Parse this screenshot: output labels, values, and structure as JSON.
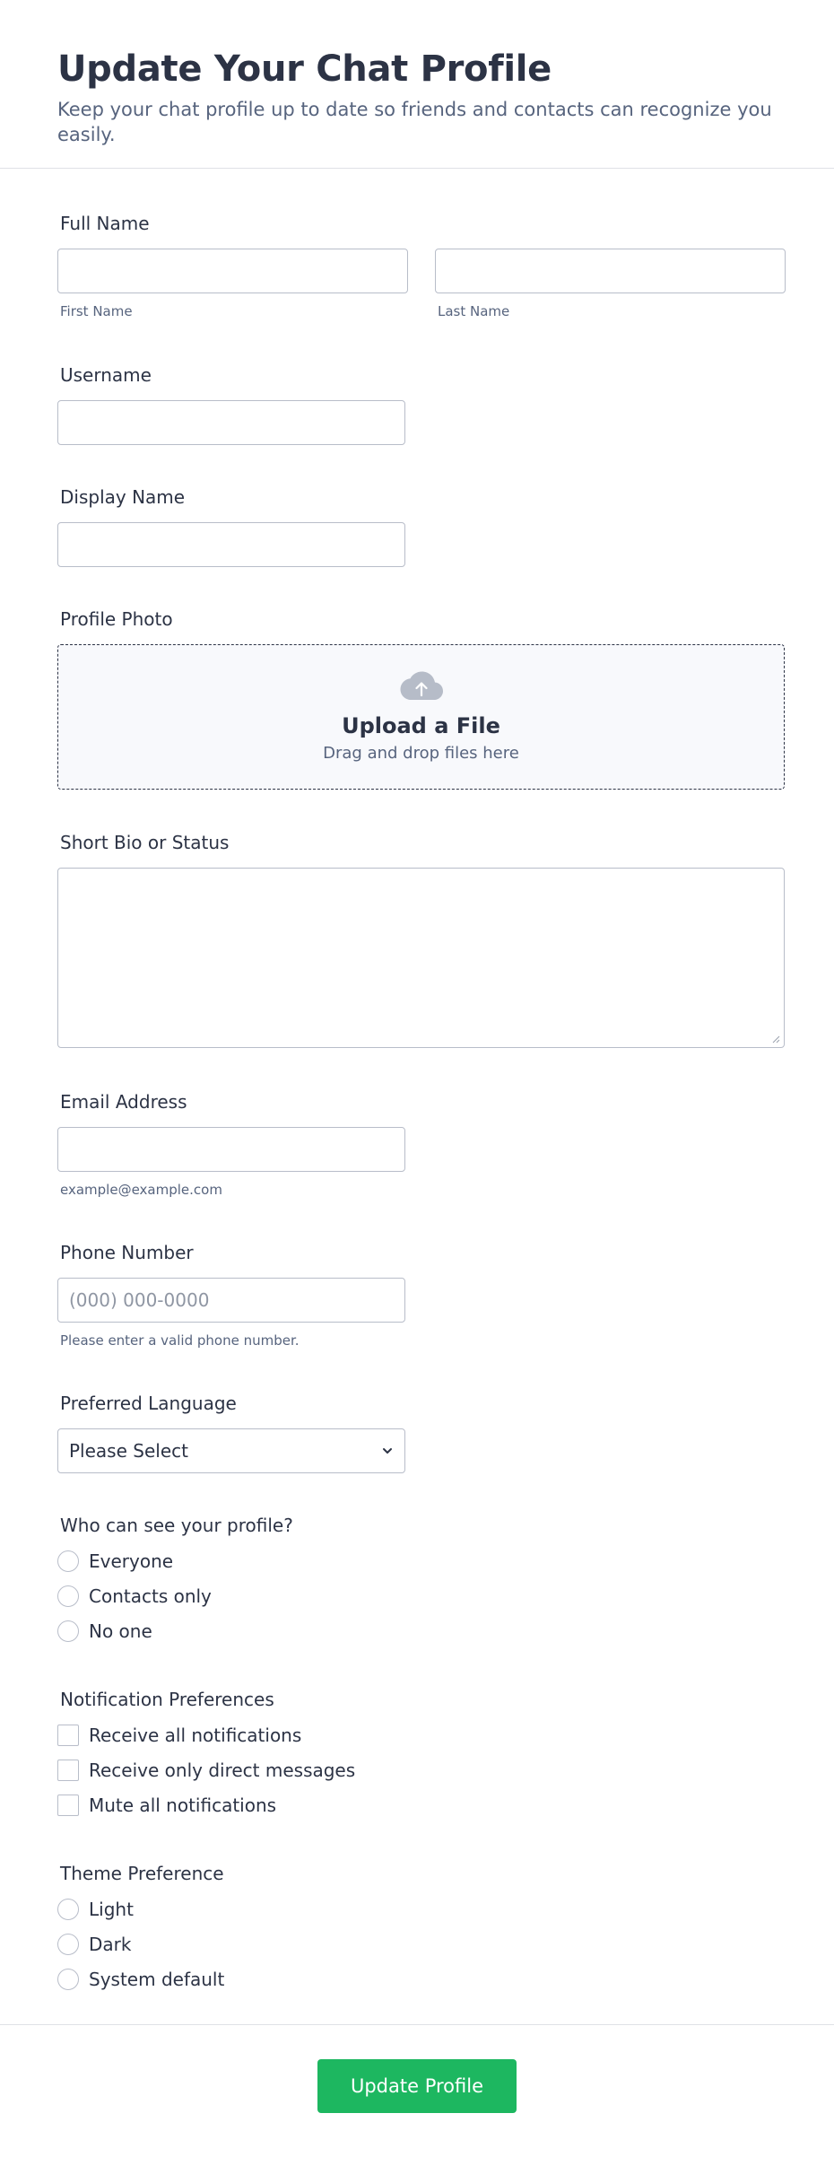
{
  "header": {
    "title": "Update Your Chat Profile",
    "subtitle": "Keep your chat profile up to date so friends and contacts can recognize you easily."
  },
  "full_name": {
    "label": "Full Name",
    "first_sublabel": "First Name",
    "last_sublabel": "Last Name",
    "first_value": "",
    "last_value": ""
  },
  "username": {
    "label": "Username",
    "value": ""
  },
  "display_name": {
    "label": "Display Name",
    "value": ""
  },
  "profile_photo": {
    "label": "Profile Photo",
    "upload_title": "Upload a File",
    "upload_hint": "Drag and drop files here",
    "icon": "cloud-upload-icon"
  },
  "bio": {
    "label": "Short Bio or Status",
    "value": ""
  },
  "email": {
    "label": "Email Address",
    "value": "",
    "sublabel": "example@example.com"
  },
  "phone": {
    "label": "Phone Number",
    "placeholder": "(000) 000-0000",
    "sublabel": "Please enter a valid phone number."
  },
  "language": {
    "label": "Preferred Language",
    "selected": "Please Select"
  },
  "visibility": {
    "label": "Who can see your profile?",
    "options": [
      "Everyone",
      "Contacts only",
      "No one"
    ]
  },
  "notifications": {
    "label": "Notification Preferences",
    "options": [
      "Receive all notifications",
      "Receive only direct messages",
      "Mute all notifications"
    ]
  },
  "theme": {
    "label": "Theme Preference",
    "options": [
      "Light",
      "Dark",
      "System default"
    ]
  },
  "submit": {
    "label": "Update Profile"
  },
  "colors": {
    "accent": "#1db760",
    "text": "#2c3345",
    "muted": "#57647e",
    "border": "#b8bdc9"
  }
}
